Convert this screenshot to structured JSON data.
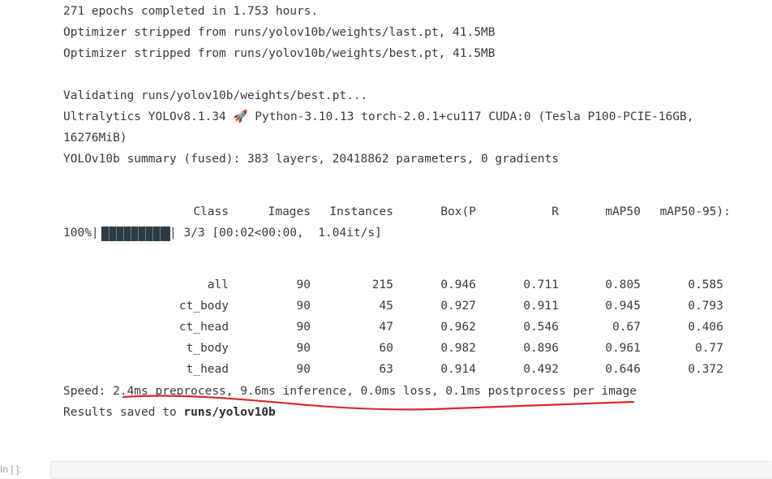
{
  "output": {
    "lines": [
      "271 epochs completed in 1.753 hours.",
      "Optimizer stripped from runs/yolov10b/weights/last.pt, 41.5MB",
      "Optimizer stripped from runs/yolov10b/weights/best.pt, 41.5MB",
      "Validating runs/yolov10b/weights/best.pt...",
      "Ultralytics YOLOv8.1.34 🚀 Python-3.10.13 torch-2.0.1+cu117 CUDA:0 (Tesla P100-PCIE-16GB,",
      "16276MiB)",
      "YOLOv10b summary (fused): 383 layers, 20418862 parameters, 0 gradients"
    ],
    "table_headers": [
      "Class",
      "Images",
      "Instances",
      "Box(P",
      "R",
      "mAP50",
      "mAP50-95):"
    ],
    "progress": {
      "pct_label": "100%|",
      "fraction": 1.0,
      "after_bar": "| 3/3 [00:02<00:00,  1.04it/s]"
    },
    "rows": [
      [
        "all",
        "90",
        "215",
        "0.946",
        "0.711",
        "0.805",
        "0.585"
      ],
      [
        "ct_body",
        "90",
        "45",
        "0.927",
        "0.911",
        "0.945",
        "0.793"
      ],
      [
        "ct_head",
        "90",
        "47",
        "0.962",
        "0.546",
        "0.67",
        "0.406"
      ],
      [
        "t_body",
        "90",
        "60",
        "0.982",
        "0.896",
        "0.961",
        "0.77"
      ],
      [
        "t_head",
        "90",
        "63",
        "0.914",
        "0.492",
        "0.646",
        "0.372"
      ]
    ],
    "speed": "Speed: 2.4ms preprocess, 9.6ms inference, 0.0ms loss, 0.1ms postprocess per image",
    "results_prefix": "Results saved to ",
    "results_path": "runs/yolov10b"
  },
  "next_cell": {
    "prompt": "In [ ]:"
  },
  "colors": {
    "annotation": "#d62a2a",
    "bar": "#2d3b45",
    "text": "#3a3a3a"
  }
}
